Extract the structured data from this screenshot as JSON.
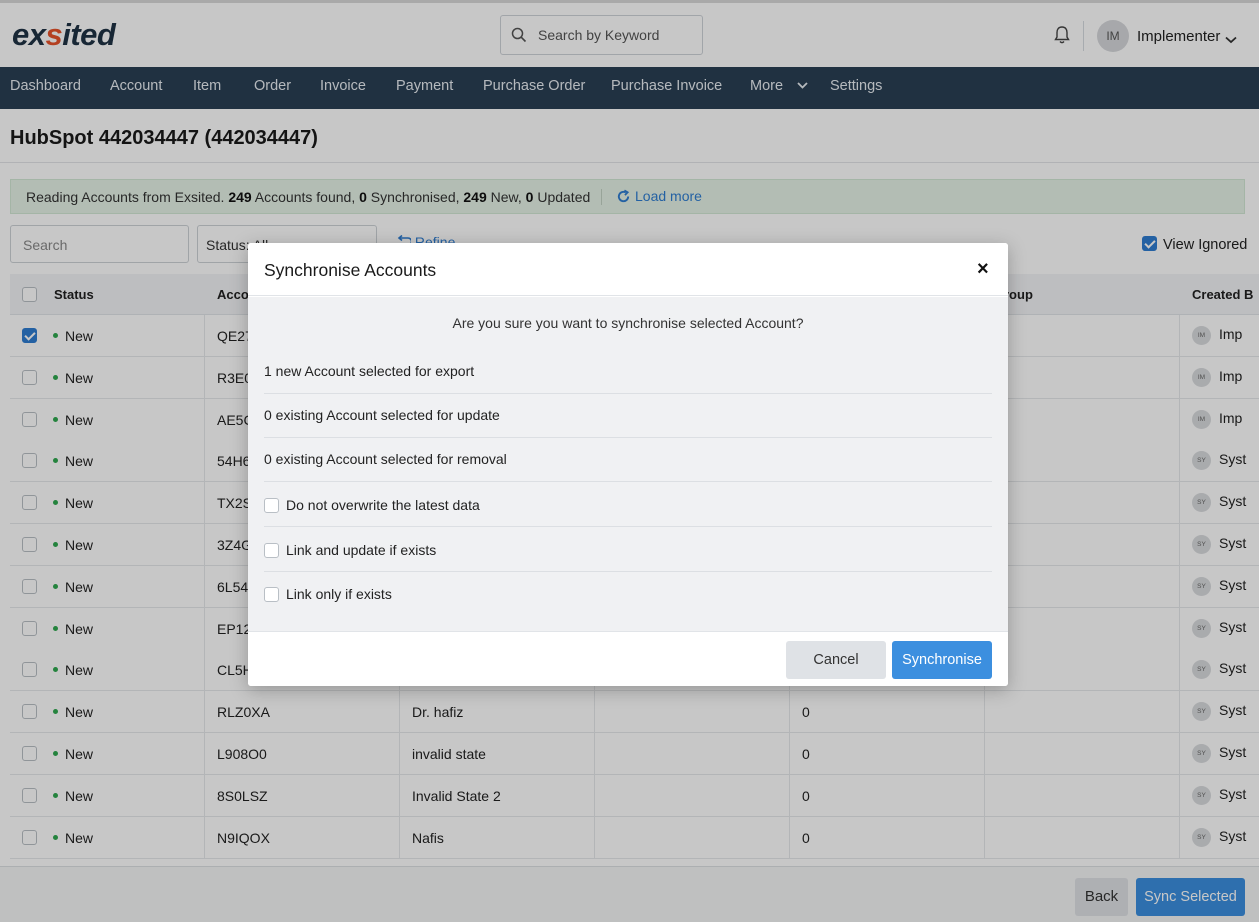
{
  "header": {
    "logo_text_1": "ex",
    "logo_text_2": "ited",
    "search_placeholder": "Search by Keyword",
    "user_initials": "IM",
    "user_name": "Implementer"
  },
  "nav": {
    "items": [
      "Dashboard",
      "Account",
      "Item",
      "Order",
      "Invoice",
      "Payment",
      "Purchase Order",
      "Purchase Invoice",
      "More",
      "Settings"
    ]
  },
  "page": {
    "title": "HubSpot 442034447 (442034447)",
    "info": {
      "prefix": "Reading Accounts from Exsited. ",
      "found": "249",
      "found_label": " Accounts found, ",
      "synced": "0",
      "synced_label": " Synchronised, ",
      "new": "249",
      "new_label": " New, ",
      "updated": "0",
      "updated_label": " Updated",
      "load_more": "Load more"
    },
    "filters": {
      "search_placeholder": "Search",
      "status_label": "Status: All",
      "refine": "Refine",
      "view_ignored": "View Ignored"
    }
  },
  "table": {
    "headers": [
      "Status",
      "Acco",
      "",
      "",
      "roup",
      "Created B"
    ],
    "rows": [
      {
        "checked": true,
        "status": "New",
        "id": "QE27",
        "name": "",
        "value": "",
        "creator_initials": "IM",
        "creator": "Imp"
      },
      {
        "checked": false,
        "status": "New",
        "id": "R3E0",
        "name": "",
        "value": "",
        "creator_initials": "IM",
        "creator": "Imp"
      },
      {
        "checked": false,
        "status": "New",
        "id": "AE5C",
        "name": "",
        "value": "",
        "creator_initials": "IM",
        "creator": "Imp"
      },
      {
        "checked": false,
        "status": "New",
        "id": "54H6",
        "name": "",
        "value": "",
        "creator_initials": "SY",
        "creator": "Syst"
      },
      {
        "checked": false,
        "status": "New",
        "id": "TX2S",
        "name": "",
        "value": "",
        "creator_initials": "SY",
        "creator": "Syst"
      },
      {
        "checked": false,
        "status": "New",
        "id": "3Z4G",
        "name": "",
        "value": "",
        "creator_initials": "SY",
        "creator": "Syst"
      },
      {
        "checked": false,
        "status": "New",
        "id": "6L54",
        "name": "",
        "value": "",
        "creator_initials": "SY",
        "creator": "Syst"
      },
      {
        "checked": false,
        "status": "New",
        "id": "EP12",
        "name": "",
        "value": "",
        "creator_initials": "SY",
        "creator": "Syst"
      },
      {
        "checked": false,
        "status": "New",
        "id": "CL5H",
        "name": "",
        "value": "",
        "creator_initials": "SY",
        "creator": "Syst"
      },
      {
        "checked": false,
        "status": "New",
        "id": "RLZ0XA",
        "name": "Dr. hafiz",
        "value": "0",
        "creator_initials": "SY",
        "creator": "Syst"
      },
      {
        "checked": false,
        "status": "New",
        "id": "L908O0",
        "name": "invalid state",
        "value": "0",
        "creator_initials": "SY",
        "creator": "Syst"
      },
      {
        "checked": false,
        "status": "New",
        "id": "8S0LSZ",
        "name": "Invalid State 2",
        "value": "0",
        "creator_initials": "SY",
        "creator": "Syst"
      },
      {
        "checked": false,
        "status": "New",
        "id": "N9IQOX",
        "name": "Nafis",
        "value": "0",
        "creator_initials": "SY",
        "creator": "Syst"
      }
    ]
  },
  "footer": {
    "back": "Back",
    "sync_selected": "Sync Selected"
  },
  "modal": {
    "title": "Synchronise Accounts",
    "close": "×",
    "question": "Are you sure you want to synchronise selected Account?",
    "line_export": "1 new Account selected for export",
    "line_update": "0 existing Account selected for update",
    "line_removal": "0 existing Account selected for removal",
    "opt_no_overwrite": "Do not overwrite the latest data",
    "opt_link_update": "Link and update if exists",
    "opt_link_only": "Link only if exists",
    "cancel": "Cancel",
    "synchronise": "Synchronise"
  },
  "colors": {
    "nav_bg": "#2a3f54",
    "primary": "#3c8fdf",
    "brand_accent": "#e7532b",
    "status_new": "#2fa84f"
  }
}
